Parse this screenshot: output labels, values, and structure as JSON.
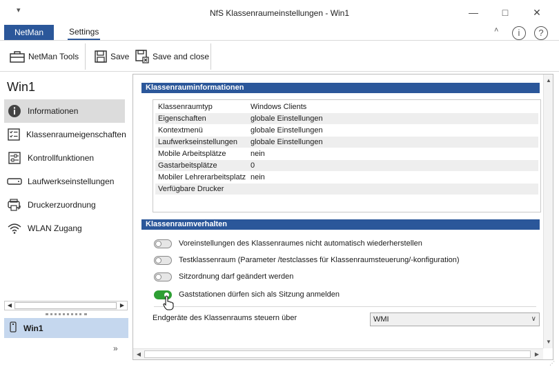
{
  "window": {
    "title": "NfS Klassenraumeinstellungen - Win1",
    "menu_glyph": "▾",
    "minimize": "—",
    "maximize": "□",
    "close": "✕"
  },
  "ribbon": {
    "tabs": [
      {
        "label": "NetMan",
        "active": false
      },
      {
        "label": "Settings",
        "active": true
      }
    ],
    "collapse_glyph": "˄",
    "info_glyph": "i",
    "help_glyph": "?"
  },
  "toolbar": {
    "netman_tools": "NetMan Tools",
    "save": "Save",
    "save_and_close": "Save and close"
  },
  "sidebar": {
    "title": "Win1",
    "items": [
      {
        "label": "Informationen",
        "icon": "info-icon",
        "active": true
      },
      {
        "label": "Klassenraumeigenschaften",
        "icon": "checklist-icon",
        "active": false
      },
      {
        "label": "Kontrollfunktionen",
        "icon": "sliders-icon",
        "active": false
      },
      {
        "label": "Laufwerkseinstellungen",
        "icon": "drive-icon",
        "active": false
      },
      {
        "label": "Druckerzuordnung",
        "icon": "printer-icon",
        "active": false
      },
      {
        "label": "WLAN Zugang",
        "icon": "wifi-icon",
        "active": false
      }
    ],
    "selected_item": "Win1",
    "more_glyph": "»"
  },
  "main": {
    "section_info": {
      "title": "Klassenrauminformationen",
      "rows": [
        {
          "key": "Klassenraumtyp",
          "value": "Windows Clients"
        },
        {
          "key": "Eigenschaften",
          "value": "globale Einstellungen"
        },
        {
          "key": "Kontextmenü",
          "value": "globale Einstellungen"
        },
        {
          "key": "Laufwerkseinstellungen",
          "value": "globale Einstellungen"
        },
        {
          "key": "Mobile Arbeitsplätze",
          "value": "nein"
        },
        {
          "key": "Gastarbeitsplätze",
          "value": "0"
        },
        {
          "key": "Mobiler Lehrerarbeitsplatz",
          "value": "nein"
        },
        {
          "key": "Verfügbare Drucker",
          "value": ""
        }
      ]
    },
    "section_behavior": {
      "title": "Klassenraumverhalten",
      "toggles": [
        {
          "label": "Voreinstellungen des Klassenraumes nicht automatisch wiederherstellen",
          "on": false
        },
        {
          "label": "Testklassenraum (Parameter /testclasses für Klassenraumsteuerung/-konfiguration)",
          "on": false
        },
        {
          "label": "Sitzordnung darf geändert werden",
          "on": false
        },
        {
          "label": "Gaststationen dürfen sich als Sitzung anmelden",
          "on": true
        }
      ],
      "control_label": "Endgeräte des Klassenraums steuern über",
      "control_value": "WMI"
    }
  },
  "colors": {
    "accent": "#2b579a",
    "toggle_on": "#2e9f34",
    "selected_bg": "#c5d7ee",
    "active_nav_bg": "#dcdcdc"
  }
}
